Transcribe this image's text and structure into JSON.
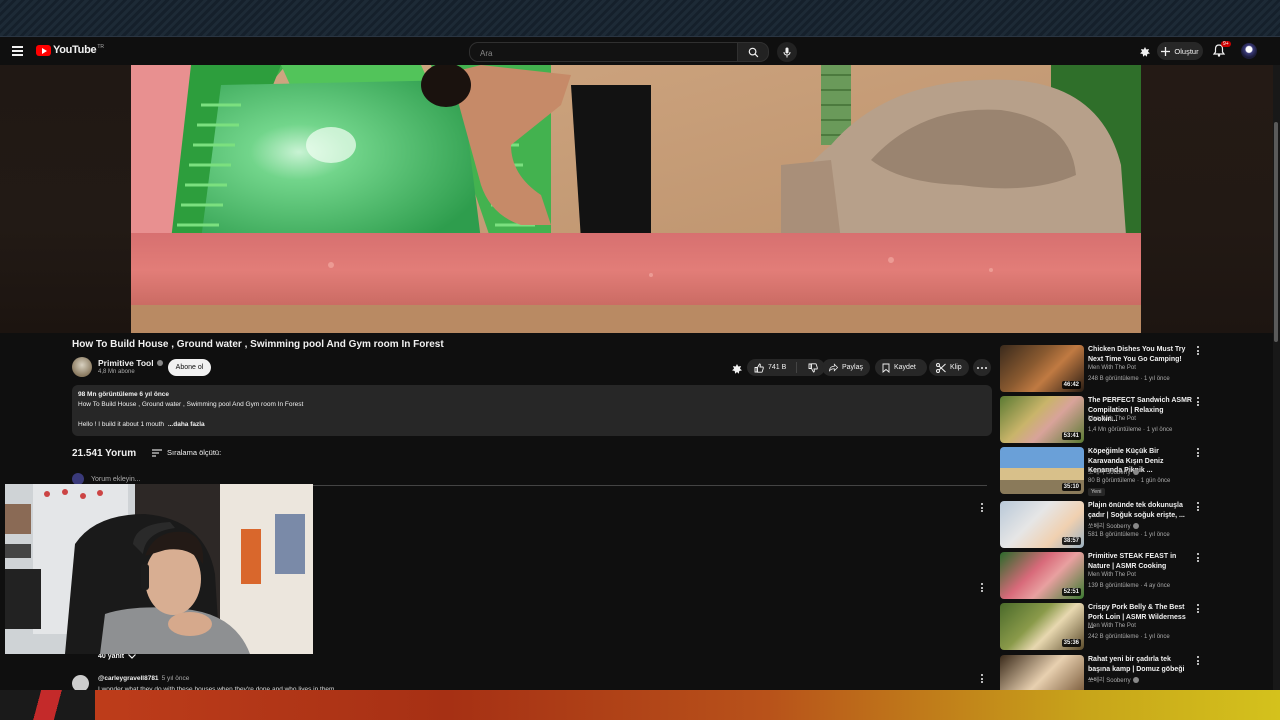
{
  "header": {
    "logo_text": "YouTube",
    "logo_country": "TR",
    "search_placeholder": "Ara",
    "create_label": "Oluştur",
    "notif_count": "9+"
  },
  "video": {
    "title": "How To Build House , Ground water , Swimming pool And Gym room In Forest",
    "channel": "Primitive Tool",
    "subscribers": "4,8 Mn abone",
    "subscribe_label": "Abone ol",
    "likes": "741 B",
    "share_label": "Paylaş",
    "save_label": "Kaydet",
    "clip_label": "Klip"
  },
  "description": {
    "stats": "98 Mn görüntüleme  6 yıl önce",
    "line": "How To Build House , Ground water , Swimming pool And Gym room In Forest",
    "snippet": "Hello ! I build it about 1 mouth",
    "more": "...daha fazla"
  },
  "comments": {
    "count_label": "21.541 Yorum",
    "sort_label": "Sıralama ölçütü:",
    "add_placeholder": "Yorum ekleyin...",
    "replies_label": "40 yanıt",
    "author": "@carleygravell8781",
    "time": "5 yıl önce",
    "text": "I wonder what they do with these houses when they're done and who lives in them"
  },
  "recommendations": [
    {
      "title": "Chicken Dishes You Must Try Next Time You Go Camping!",
      "channel": "Men With The Pot",
      "verified": false,
      "meta": "248 B görüntüleme · 1 yıl önce",
      "duration": "46:42",
      "new": ""
    },
    {
      "title": "The PERFECT Sandwich ASMR Compilation | Relaxing Cookin...",
      "channel": "Men With The Pot",
      "verified": false,
      "meta": "1,4 Mn görüntüleme · 1 yıl önce",
      "duration": "53:41",
      "new": ""
    },
    {
      "title": "Köpeğimle Küçük Bir Karavanda Kışın Deniz Kenarında Piknik ...",
      "channel": "쏘베리 Sooberry",
      "verified": true,
      "meta": "80 B görüntüleme · 1 gün önce",
      "duration": "35:10",
      "new": "Yeni"
    },
    {
      "title": "Plajın önünde tek dokunuşla çadır | Soğuk soğuk erişte, ...",
      "channel": "쏘베리 Sooberry",
      "verified": true,
      "meta": "581 B görüntüleme · 1 yıl önce",
      "duration": "38:57",
      "new": ""
    },
    {
      "title": "Primitive STEAK FEAST in Nature | ASMR Cooking",
      "channel": "Men With The Pot",
      "verified": false,
      "meta": "139 B görüntüleme · 4 ay önce",
      "duration": "52:51",
      "new": ""
    },
    {
      "title": "Crispy Pork Belly & The Best Pork Loin | ASMR Wilderness ...",
      "channel": "Men With The Pot",
      "verified": false,
      "meta": "242 B görüntüleme · 1 yıl önce",
      "duration": "35:36",
      "new": ""
    },
    {
      "title": "Rahat yeni bir çadırla tek başına kamp | Domuz göbeği ...",
      "channel": "쏘베리 Sooberry",
      "verified": true,
      "meta": "",
      "duration": "",
      "new": ""
    }
  ]
}
